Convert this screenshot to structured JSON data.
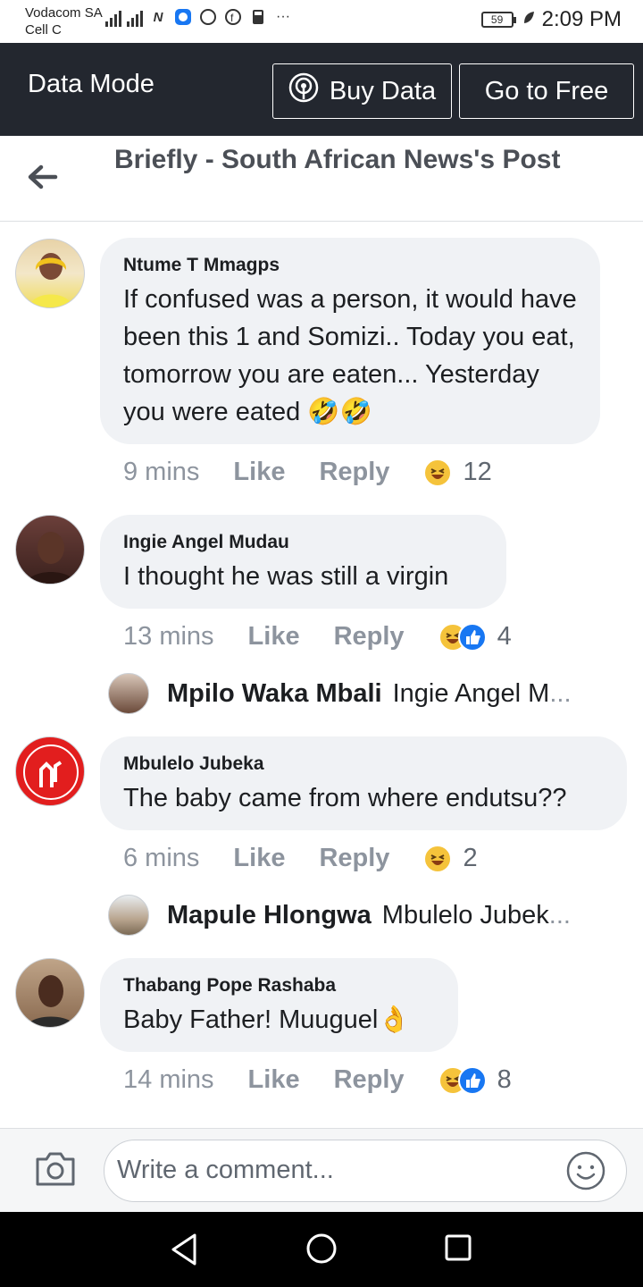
{
  "status_bar": {
    "carrier_line1": "Vodacom SA",
    "carrier_line2": "Cell C",
    "battery": "59",
    "time": "2:09 PM",
    "icons": [
      "signal-icon",
      "signal-icon",
      "n-app-icon",
      "messenger-icon",
      "whatsapp-icon",
      "facebook-icon",
      "cup-icon",
      "more-icon",
      "leaf-icon"
    ]
  },
  "data_bar": {
    "title": "Data Mode",
    "buy_label": "Buy Data",
    "free_label": "Go to Free"
  },
  "header": {
    "title": "Briefly - South African News's Post"
  },
  "comments": [
    {
      "author": "Ntume T Mmagps",
      "text": "If confused was a person, it would have been this 1 and Somizi.. Today you eat, tomorrow you are eaten... Yesterday you were eated 🤣🤣",
      "time": "9 mins",
      "like": "Like",
      "reply": "Reply",
      "reactions": [
        "haha"
      ],
      "count": "12"
    },
    {
      "author": "Ingie Angel Mudau",
      "text": "I thought he was still a virgin",
      "time": "13 mins",
      "like": "Like",
      "reply": "Reply",
      "reactions": [
        "haha",
        "like"
      ],
      "count": "4",
      "reply_preview": {
        "name": "Mpilo Waka Mbali",
        "snippet": "Ingie Angel M",
        "ellipsis": "..."
      }
    },
    {
      "author": "Mbulelo Jubeka",
      "text": "The baby came from where endutsu??",
      "time": "6 mins",
      "like": "Like",
      "reply": "Reply",
      "reactions": [
        "haha"
      ],
      "count": "2",
      "reply_preview": {
        "name": "Mapule Hlongwa",
        "snippet": "Mbulelo Jubek",
        "ellipsis": "..."
      }
    },
    {
      "author": "Thabang Pope Rashaba",
      "text": "Baby Father! Muuguel👌",
      "time": "14 mins",
      "like": "Like",
      "reply": "Reply",
      "reactions": [
        "haha",
        "like"
      ],
      "count": "8"
    }
  ],
  "composer": {
    "placeholder": "Write a comment..."
  },
  "colors": {
    "data_bar_bg": "#23272f",
    "bubble_bg": "#f0f2f5",
    "meta_text": "#8d949e",
    "like_blue": "#1877f2",
    "haha_yellow": "#f5c33b"
  }
}
